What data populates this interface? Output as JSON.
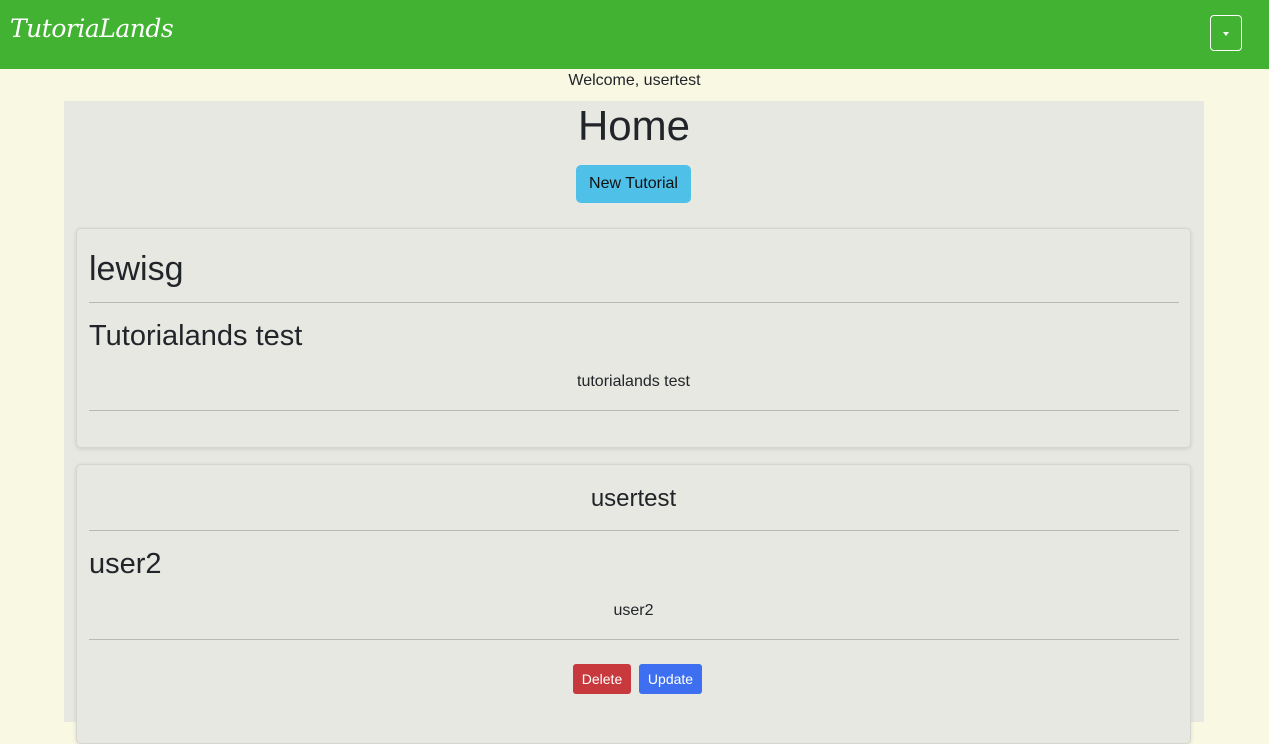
{
  "navbar": {
    "brand": "TutoriaLands",
    "toggle_icon": "caret-down-icon"
  },
  "welcome_text": "Welcome, usertest",
  "page": {
    "title": "Home",
    "new_button_label": "New Tutorial"
  },
  "posts": [
    {
      "author": "lewisg",
      "title": "Tutorialands test",
      "body": "tutorialands test",
      "actions": []
    },
    {
      "author": "usertest",
      "title": "user2",
      "body": "user2",
      "actions": [
        "Delete",
        "Update"
      ]
    }
  ],
  "colors": {
    "navbar": "#42b232",
    "background": "#f9f8e3",
    "panel": "#e8e8e3",
    "new_button": "#4fc0e8",
    "delete": "#c8393d",
    "update": "#3e6ff0"
  }
}
